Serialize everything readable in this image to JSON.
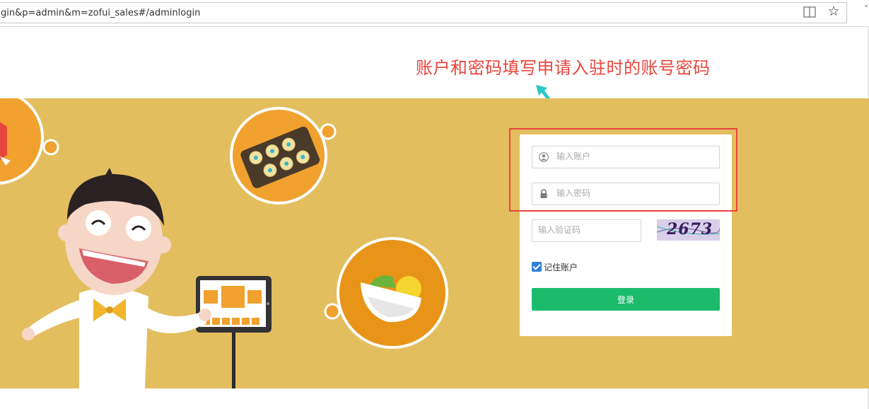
{
  "browser": {
    "url": "gin&p=admin&m=zofui_sales#/adminlogin",
    "reader_icon": "reader-view-icon",
    "bookmark_icon": "star-icon"
  },
  "annotation": {
    "text": "账户和密码填写申请入驻时的账号密码",
    "color": "#e8453c"
  },
  "login": {
    "account_placeholder": "输入账户",
    "password_placeholder": "输入密码",
    "captcha_placeholder": "输入验证码",
    "captcha_image_text": "2673",
    "remember_label": "记住账户",
    "remember_checked": true,
    "submit_label": "登录"
  },
  "colors": {
    "banner": "#e3be5f",
    "button": "#1bbb6c",
    "frame": "#e8453c",
    "arrow": "#2ec7c9"
  }
}
